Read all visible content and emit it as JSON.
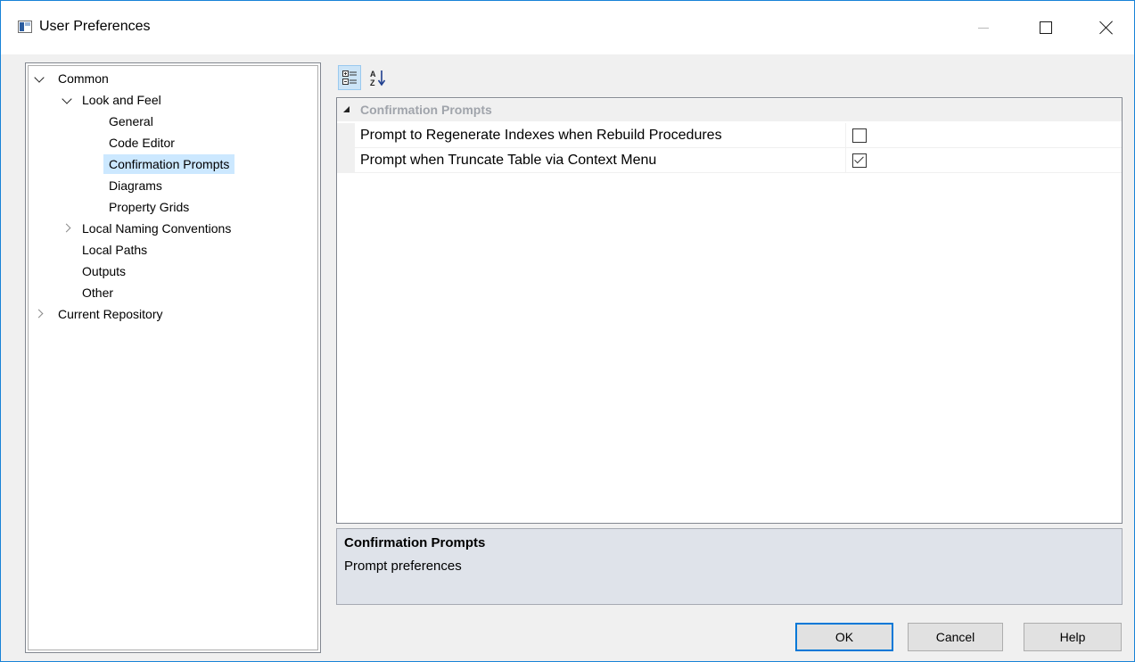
{
  "window": {
    "title": "User Preferences"
  },
  "tree": {
    "items": [
      {
        "label": "Common"
      },
      {
        "label": "Look and Feel"
      },
      {
        "label": "General"
      },
      {
        "label": "Code Editor"
      },
      {
        "label": "Confirmation Prompts",
        "selected": true
      },
      {
        "label": "Diagrams"
      },
      {
        "label": "Property Grids"
      },
      {
        "label": "Local Naming Conventions"
      },
      {
        "label": "Local Paths"
      },
      {
        "label": "Outputs"
      },
      {
        "label": "Other"
      },
      {
        "label": "Current Repository"
      }
    ]
  },
  "toolbar": {
    "categorized_icon": "categorized-icon",
    "alphabetical_icon": "sort-alphabetical-icon"
  },
  "grid": {
    "category": "Confirmation Prompts",
    "properties": [
      {
        "name": "Prompt to Regenerate Indexes when Rebuild Procedures",
        "checked": false
      },
      {
        "name": "Prompt when Truncate Table via Context Menu",
        "checked": true
      }
    ]
  },
  "description": {
    "title": "Confirmation Prompts",
    "text": "Prompt preferences"
  },
  "buttons": {
    "ok": "OK",
    "cancel": "Cancel",
    "help": "Help"
  },
  "colors": {
    "accent": "#0078d7",
    "selection": "#cce8ff",
    "description_bg": "#dfe3ea"
  }
}
